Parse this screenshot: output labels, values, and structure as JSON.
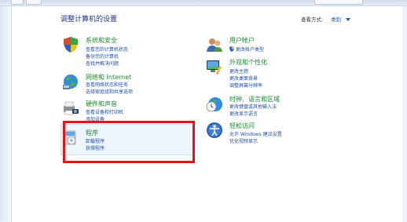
{
  "header": {
    "title": "调整计算机的设置",
    "view_by_label": "查看方式:",
    "view_by_value": "类别"
  },
  "left_column": [
    {
      "title": "系统和安全",
      "links": [
        "查看您的计算机状态",
        "备份您的计算机",
        "查找并解决问题"
      ]
    },
    {
      "title": "网络和 Internet",
      "links": [
        "查看网络状态和任务",
        "选择家庭组和共享选项"
      ]
    },
    {
      "title": "硬件和声音",
      "links": [
        "查看设备和打印机",
        "添加设备"
      ]
    },
    {
      "title": "程序",
      "links": [
        "卸载程序",
        "获得程序"
      ]
    }
  ],
  "right_column": [
    {
      "title": "用户帐户",
      "links": [
        "更改帐户类型"
      ]
    },
    {
      "title": "外观和个性化",
      "links": [
        "更改主题",
        "更改桌面背景",
        "调整屏幕分辨率"
      ]
    },
    {
      "title": "时钟、语言和区域",
      "links": [
        "更改键盘或其他输入法",
        "更改显示语言"
      ]
    },
    {
      "title": "轻松访问",
      "links": [
        "允许 Windows 建议设置",
        "优化视频显示"
      ]
    }
  ],
  "colors": {
    "category_title": "#1b8a2e",
    "link": "#1e4ea8",
    "highlight_box": "#e8121a"
  }
}
